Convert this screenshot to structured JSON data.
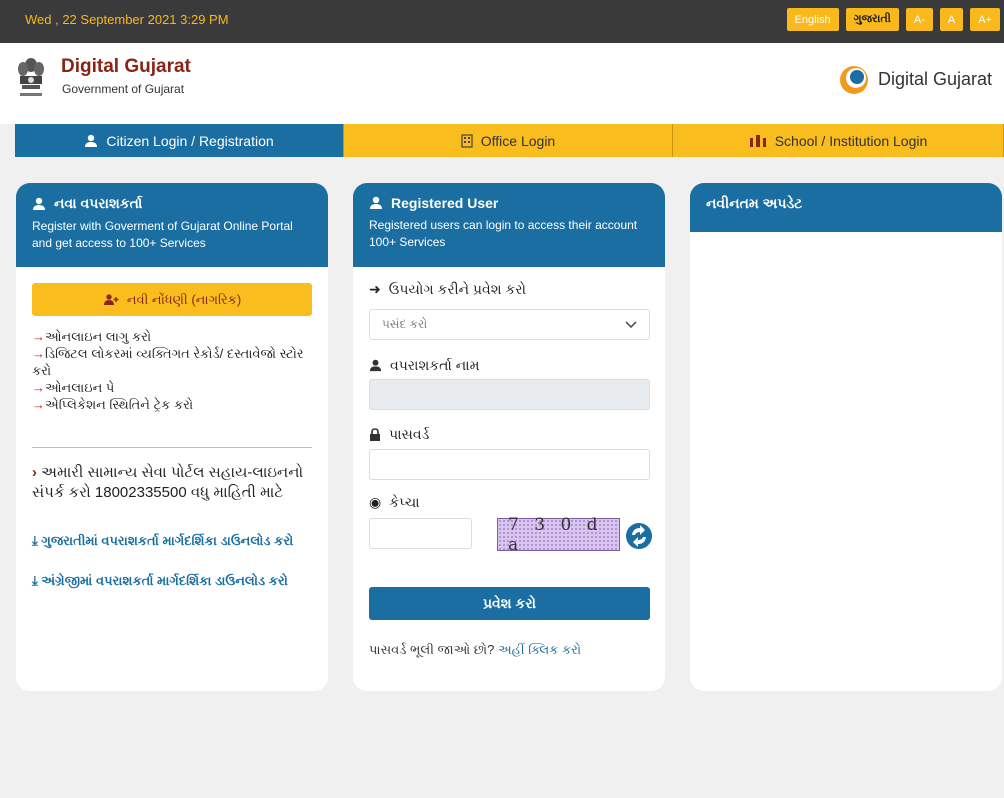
{
  "topbar": {
    "datetime": "Wed , 22 September 2021 3:29 PM",
    "buttons": [
      "English",
      "ગુજરાતી",
      "A-",
      "A",
      "A+"
    ]
  },
  "header": {
    "title": "Digital Gujarat",
    "subtitle": "Government of Gujarat",
    "logo_text": "Digital Gujarat"
  },
  "nav": {
    "tabs": [
      {
        "label": "Citizen Login / Registration",
        "icon": "user-icon"
      },
      {
        "label": "Office Login",
        "icon": "building-icon"
      },
      {
        "label": "School / Institution Login",
        "icon": "institution-icon"
      }
    ]
  },
  "new_user": {
    "title": "નવા વપરાશકર્તા",
    "description": "Register with Goverment of Gujarat Online Portal and get access to 100+ Services",
    "register_button": "નવી નોંધણી (નાગરિક)",
    "links": [
      "ઓનલાઇન લાગુ કરો",
      "ડિજિટલ લોકરમાં વ્યક્તિગત રેકોર્ડ/ દસ્તાવેજો સ્ટોર કરો",
      "ઓનલાઇન પે",
      "એપ્લિકેશન સ્થિતિને ટ્રેક કરો"
    ],
    "helpline": "અમારી સામાન્ય સેવા પોર્ટલ સહાય-લાઇનનો સંપર્ક કરો 18002335500 વધુ માહિતી માટે",
    "download_gujarati": "ગુજરાતીમાં વપરાશકર્તા માર્ગદર્શિકા ડાઉનલોડ કરો",
    "download_english": "અંગ્રેજીમાં વપરાશકર્તા માર્ગદર્શિકા ડાઉનલોડ કરો"
  },
  "registered_user": {
    "title": "Registered User",
    "description": "Registered users can login to access their account 100+ Services",
    "login_with_label": "ઉપયોગ કરીને પ્રવેશ કરો",
    "select_value": "પસંદ કરો",
    "username_label": "વપરાશકર્તા નામ",
    "username_value": "",
    "password_label": "પાસવર્ડ",
    "password_value": "",
    "captcha_label": "કેપ્ચા",
    "captcha_input_value": "",
    "captcha_text": "7 3 0 d a",
    "login_button": "પ્રવેશ કરો",
    "forgot_text": "પાસવર્ડ ભૂલી જાઓ છો?",
    "forgot_link": "અહીં ક્લિક કરો"
  },
  "updates": {
    "title": "નવીનતમ અપડેટ"
  },
  "colors": {
    "primary_blue": "#1a6ea1",
    "accent_yellow": "#f9bd1e",
    "brand_maroon": "#8a2415",
    "topbar_dark": "#3a3a3a"
  }
}
